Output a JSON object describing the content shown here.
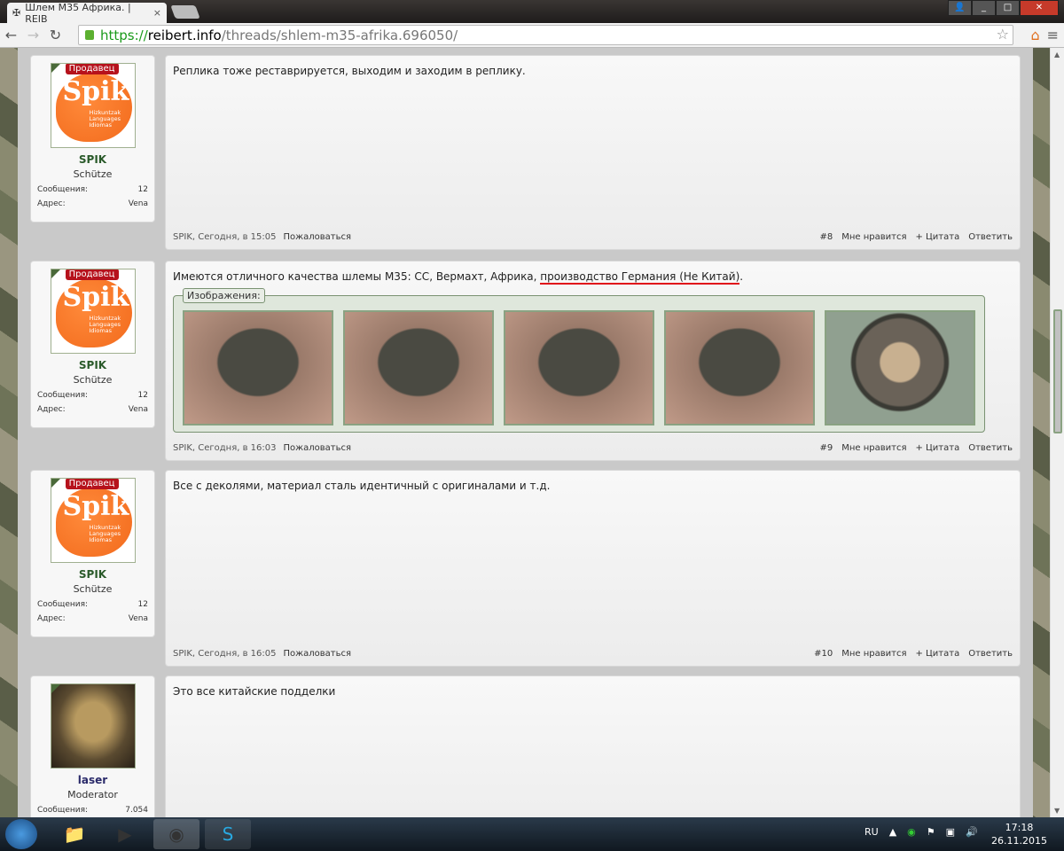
{
  "browser": {
    "tab_title": "Шлем М35 Африка. | REIB",
    "url_scheme": "https://",
    "url_host": "reibert.info",
    "url_path": "/threads/shlem-m35-afrika.696050/"
  },
  "posts": [
    {
      "user": "SPIK",
      "badge": "Продавец",
      "title": "Schütze",
      "posts_label": "Сообщения:",
      "posts_count": "12",
      "addr_label": "Адрес:",
      "addr": "Vena",
      "text": "Реплика тоже реставрируется, выходим и заходим в реплику.",
      "meta": "SPIK, Сегодня, в 15:05",
      "report": "Пожаловаться",
      "num": "#8"
    },
    {
      "user": "SPIK",
      "badge": "Продавец",
      "title": "Schütze",
      "posts_label": "Сообщения:",
      "posts_count": "12",
      "addr_label": "Адрес:",
      "addr": "Vena",
      "text_a": "Имеются отличного качества шлемы М35: СС, Вермахт, Африка, ",
      "text_hl": "производство Германия (Не Китай)",
      "text_b": ".",
      "images_label": "Изображения:",
      "meta": "SPIK, Сегодня, в 16:03",
      "report": "Пожаловаться",
      "num": "#9"
    },
    {
      "user": "SPIK",
      "badge": "Продавец",
      "title": "Schütze",
      "posts_label": "Сообщения:",
      "posts_count": "12",
      "addr_label": "Адрес:",
      "addr": "Vena",
      "text": "Все с деколями, материал сталь идентичный с оригиналами и т.д.",
      "meta": "SPIK, Сегодня, в 16:05",
      "report": "Пожаловаться",
      "num": "#10"
    },
    {
      "user": "laser",
      "title": "Moderator",
      "posts_label": "Сообщения:",
      "posts_count": "7.054",
      "text": "Это все китайские подделки"
    }
  ],
  "actions": {
    "like": "Мне нравится",
    "quote": "+ Цитата",
    "reply": "Ответить"
  },
  "logo": {
    "big": "Spik",
    "small": "Hizkuntzak Languages Idiomas"
  },
  "taskbar": {
    "lang": "RU",
    "time": "17:18",
    "date": "26.11.2015"
  }
}
